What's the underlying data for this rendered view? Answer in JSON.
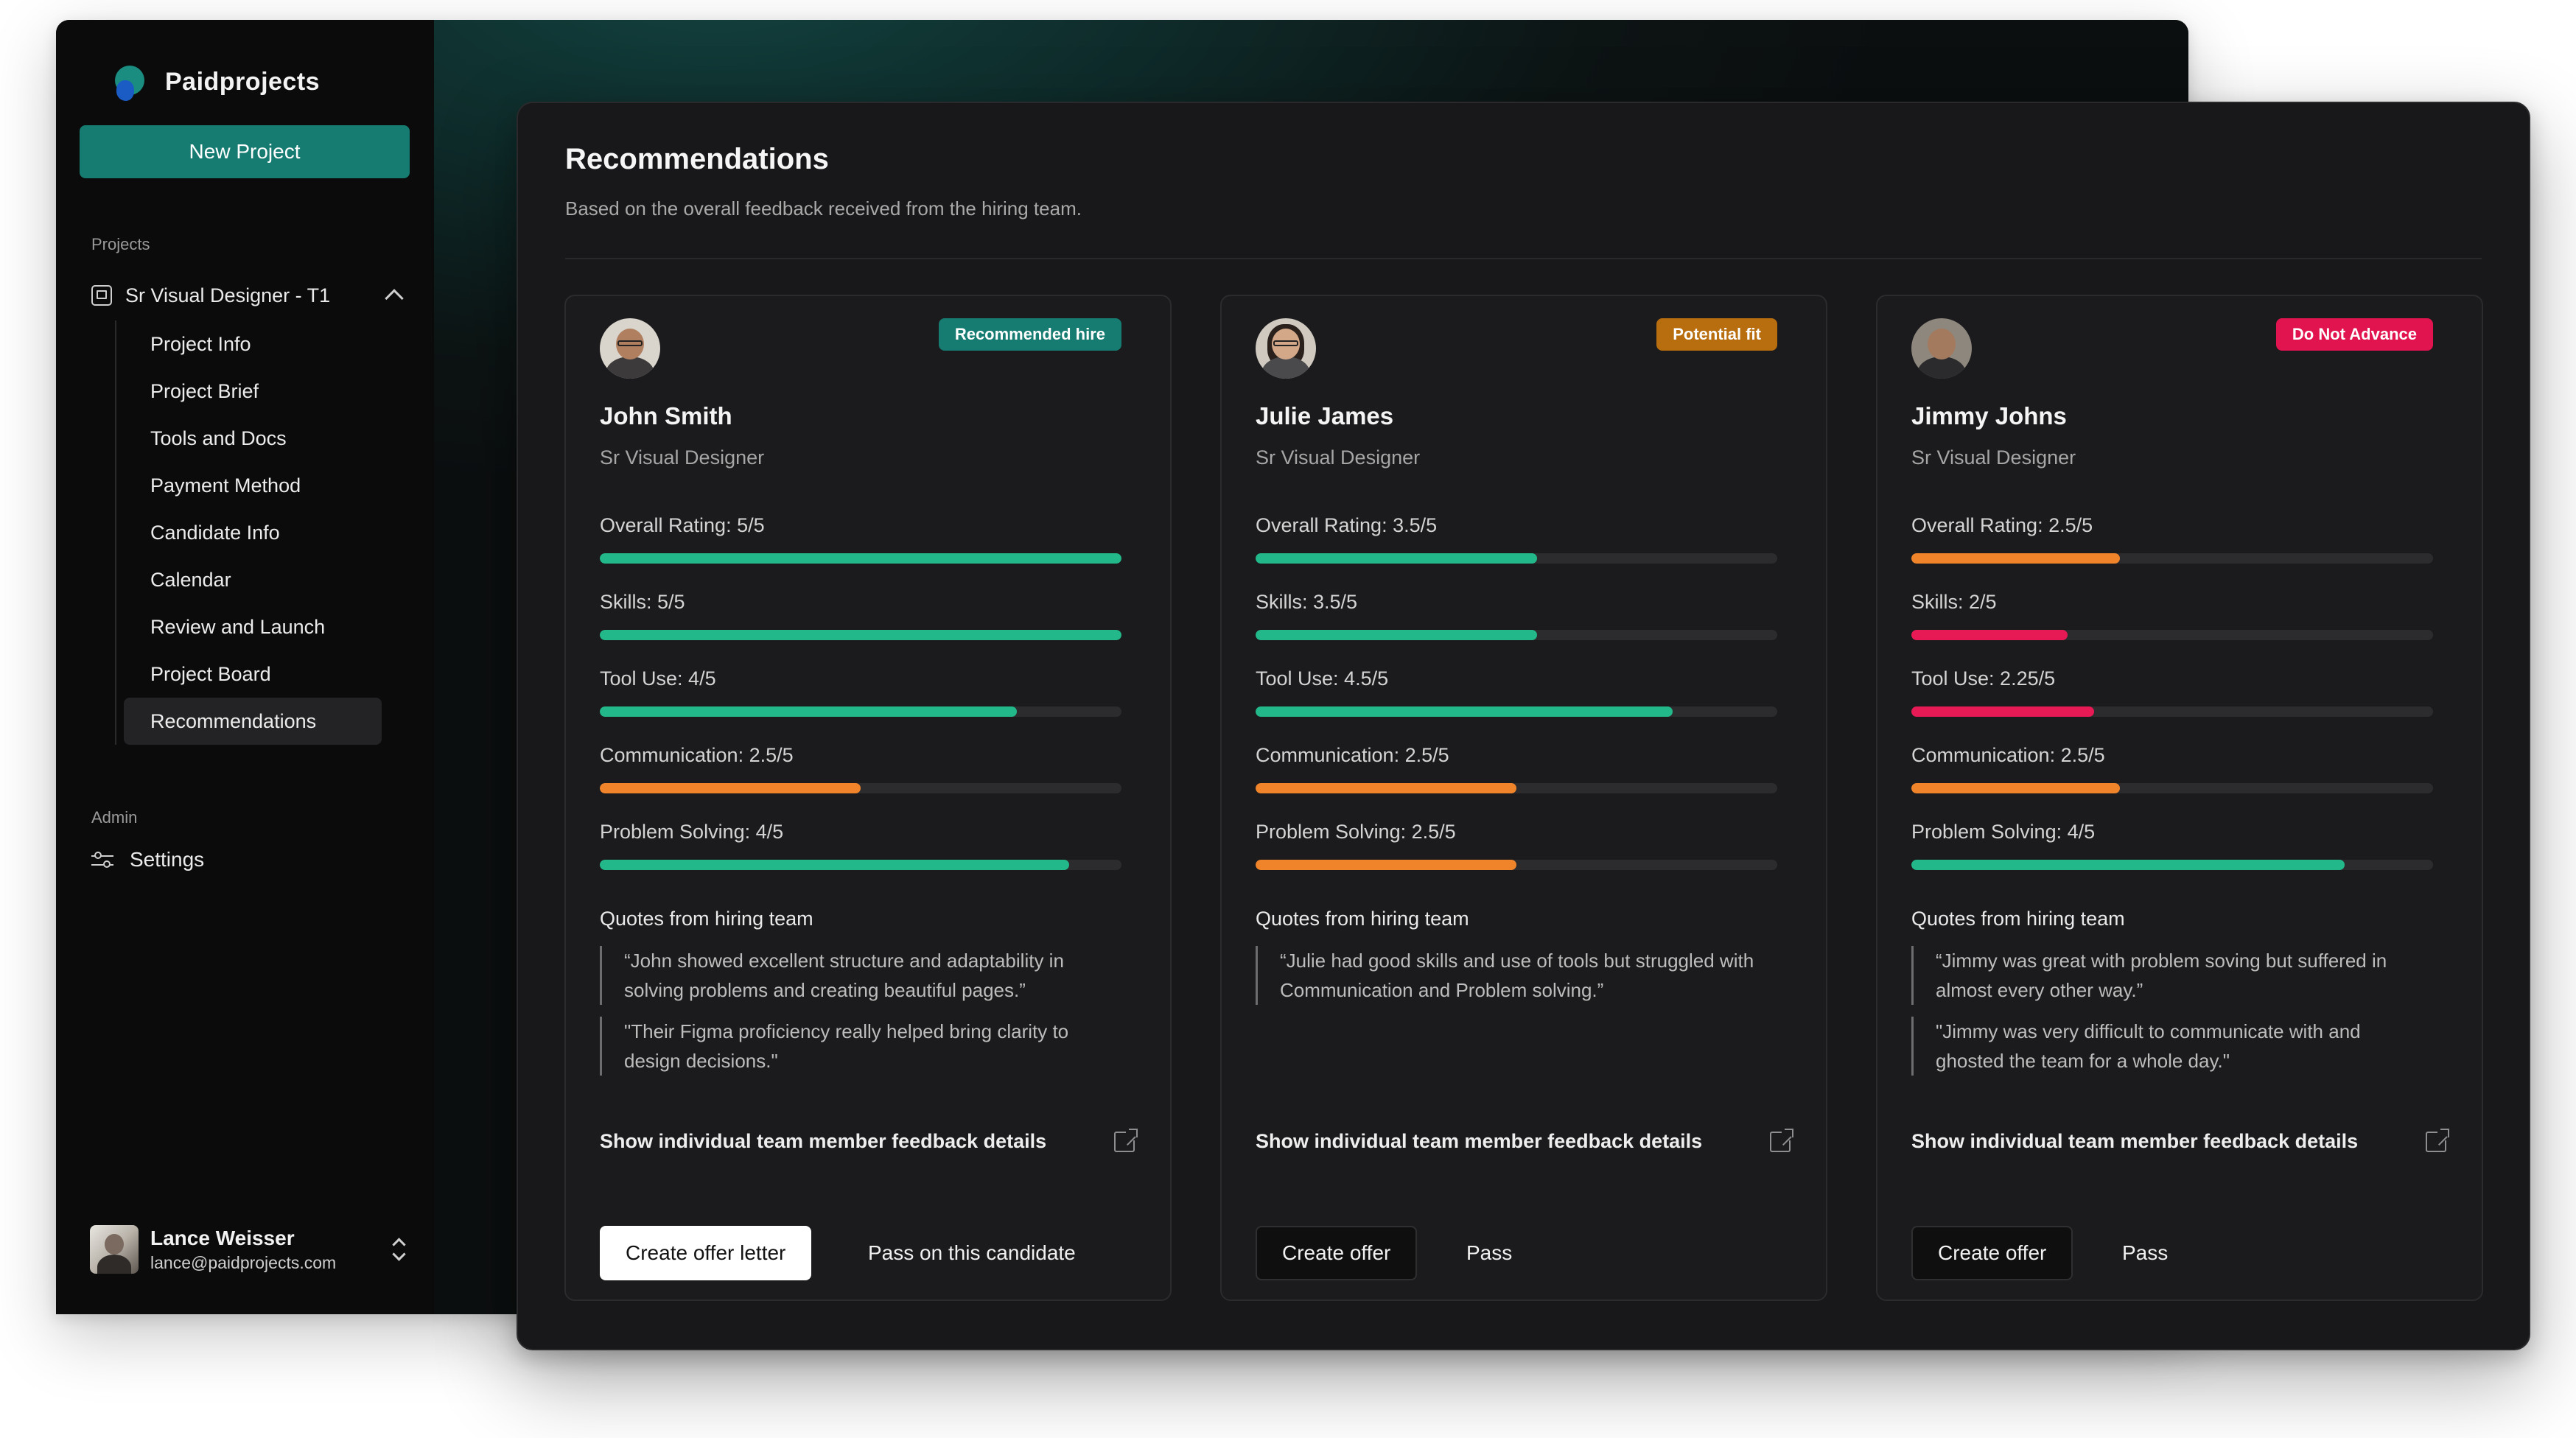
{
  "sidebar": {
    "brand": "Paidprojects",
    "new_project_label": "New Project",
    "projects_label": "Projects",
    "project_name": "Sr Visual Designer - T1",
    "items": [
      {
        "label": "Project Info"
      },
      {
        "label": "Project Brief"
      },
      {
        "label": "Tools and Docs"
      },
      {
        "label": "Payment Method"
      },
      {
        "label": "Candidate Info"
      },
      {
        "label": "Calendar"
      },
      {
        "label": "Review and Launch"
      },
      {
        "label": "Project Board"
      },
      {
        "label": "Recommendations",
        "active": true
      }
    ],
    "admin_label": "Admin",
    "settings_label": "Settings",
    "user": {
      "name": "Lance Weisser",
      "email": "lance@paidprojects.com"
    }
  },
  "panel": {
    "title": "Recommendations",
    "subtitle": "Based on the overall feedback received from the hiring team."
  },
  "colors": {
    "green": "#23b889",
    "orange": "#f0842a",
    "red": "#e71a55",
    "badge_green": "#167c72",
    "badge_orange": "#b86e0e",
    "badge_red": "#e2144f"
  },
  "candidates": [
    {
      "name": "John Smith",
      "role": "Sr Visual Designer",
      "badge": "Recommended hire",
      "badge_color": "#167c72",
      "metrics": [
        {
          "label": "Overall Rating: 5/5",
          "value": 5,
          "max": 5,
          "color": "#23b889"
        },
        {
          "label": "Skills: 5/5",
          "value": 5,
          "max": 5,
          "color": "#23b889"
        },
        {
          "label": "Tool Use: 4/5",
          "value": 4,
          "max": 5,
          "color": "#23b889"
        },
        {
          "label": "Communication: 2.5/5",
          "value": 2.5,
          "max": 5,
          "color": "#f0842a"
        },
        {
          "label": "Problem Solving: 4/5",
          "value": 4.5,
          "max": 5,
          "color": "#23b889"
        }
      ],
      "quotes_title": "Quotes from hiring team",
      "quotes": [
        "“John showed excellent structure and adaptability in solving problems and creating beautiful pages.”",
        "\"Their Figma proficiency really helped bring clarity to design decisions.\""
      ],
      "feedback_link": "Show individual team member feedback details",
      "primary_action": "Create offer letter",
      "secondary_action": "Pass on this candidate"
    },
    {
      "name": "Julie James",
      "role": "Sr Visual Designer",
      "badge": "Potential fit",
      "badge_color": "#b86e0e",
      "metrics": [
        {
          "label": "Overall Rating: 3.5/5",
          "value": 2.7,
          "max": 5,
          "color": "#23b889"
        },
        {
          "label": "Skills: 3.5/5",
          "value": 2.7,
          "max": 5,
          "color": "#23b889"
        },
        {
          "label": "Tool Use: 4.5/5",
          "value": 4,
          "max": 5,
          "color": "#23b889"
        },
        {
          "label": "Communication: 2.5/5",
          "value": 2.5,
          "max": 5,
          "color": "#f0842a"
        },
        {
          "label": "Problem Solving: 2.5/5",
          "value": 2.5,
          "max": 5,
          "color": "#f0842a"
        }
      ],
      "quotes_title": "Quotes from hiring team",
      "quotes": [
        "“Julie had good skills and use of tools but struggled with Communication and Problem solving.”"
      ],
      "feedback_link": "Show individual team member feedback details",
      "primary_action": "Create offer",
      "secondary_action": "Pass"
    },
    {
      "name": "Jimmy Johns",
      "role": "Sr Visual Designer",
      "badge": "Do Not Advance",
      "badge_color": "#e2144f",
      "metrics": [
        {
          "label": "Overall Rating: 2.5/5",
          "value": 2,
          "max": 5,
          "color": "#f0842a"
        },
        {
          "label": "Skills: 2/5",
          "value": 1.5,
          "max": 5,
          "color": "#e71a55"
        },
        {
          "label": "Tool Use: 2.25/5",
          "value": 1.75,
          "max": 5,
          "color": "#e71a55"
        },
        {
          "label": "Communication: 2.5/5",
          "value": 2,
          "max": 5,
          "color": "#f0842a"
        },
        {
          "label": "Problem Solving: 4/5",
          "value": 4.15,
          "max": 5,
          "color": "#23b889"
        }
      ],
      "quotes_title": "Quotes from hiring team",
      "quotes": [
        "“Jimmy was great with problem soving but suffered in almost every other way.”",
        "\"Jimmy was very difficult to communicate with and ghosted the team for a whole day.\""
      ],
      "feedback_link": "Show individual team member feedback details",
      "primary_action": "Create offer",
      "secondary_action": "Pass"
    }
  ]
}
